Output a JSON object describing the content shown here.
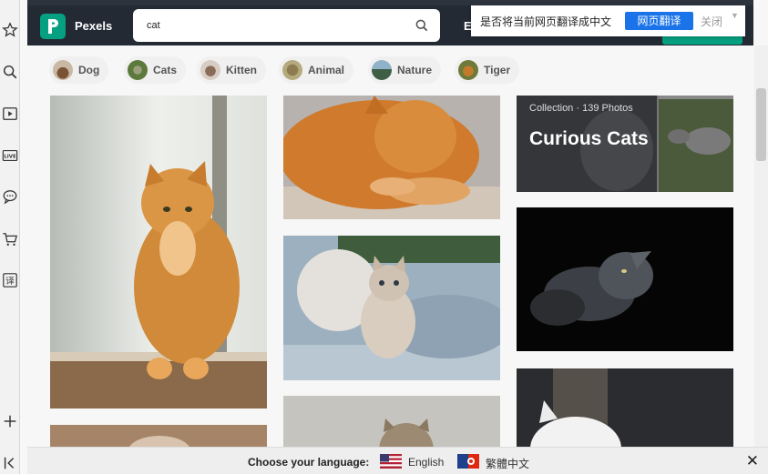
{
  "header": {
    "brand": "Pexels",
    "search_value": "cat",
    "explore_label": "E"
  },
  "translate_bar": {
    "prompt": "是否将当前网页翻译成中文",
    "translate_button": "网页翻译",
    "close_label": "关闭"
  },
  "categories": [
    {
      "label": "Dog"
    },
    {
      "label": "Cats"
    },
    {
      "label": "Kitten"
    },
    {
      "label": "Animal"
    },
    {
      "label": "Nature"
    },
    {
      "label": "Tiger"
    }
  ],
  "collection": {
    "meta": "Collection · 139 Photos",
    "title": "Curious Cats"
  },
  "language_bar": {
    "label": "Choose your language:",
    "option_english": "English",
    "option_chinese": "繁體中文"
  },
  "icons": {
    "sidebar": [
      "star-icon",
      "search-icon",
      "video-icon",
      "live-icon",
      "chat-icon",
      "cart-icon",
      "translate-icon",
      "plus-icon",
      "collapse-icon"
    ],
    "brand_color": "#05a081",
    "header_color": "#232a34",
    "translate_color": "#1a73e8"
  }
}
